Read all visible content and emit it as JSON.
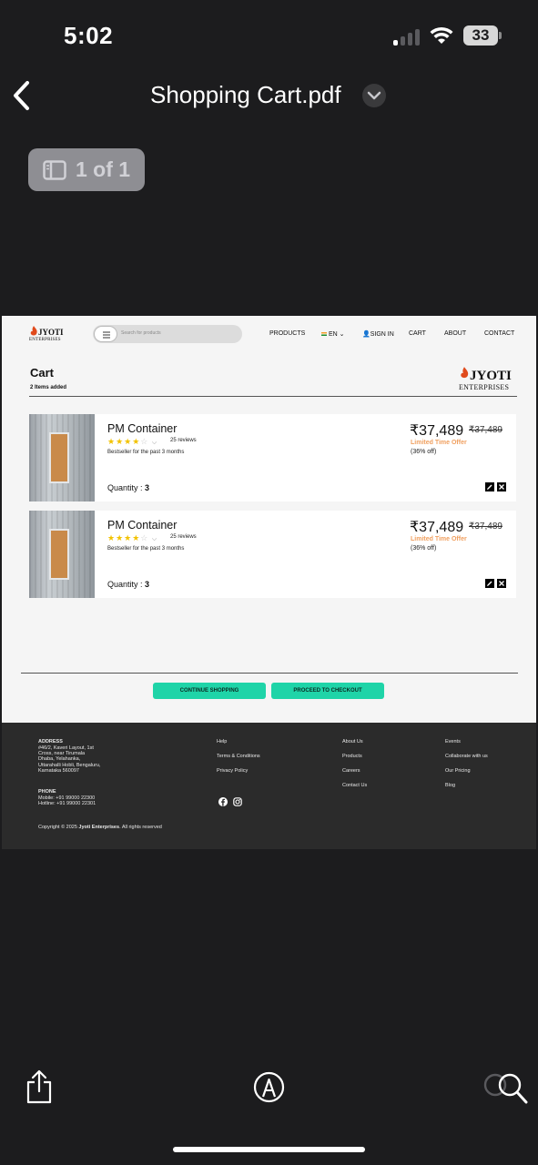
{
  "status_bar": {
    "time": "5:02",
    "battery": "33"
  },
  "header": {
    "title": "Shopping Cart.pdf"
  },
  "page_indicator": "1 of 1",
  "site": {
    "logo_brand": "JYOTI",
    "logo_sub": "ENTERPRISES",
    "search_placeholder": "Search for products",
    "nav": [
      "PRODUCTS",
      "EN",
      "SIGN IN",
      "CART",
      "ABOUT",
      "CONTACT"
    ]
  },
  "cart": {
    "title": "Cart",
    "count": "2 Items added",
    "items": [
      {
        "name": "PM Container",
        "rating": 4,
        "reviews": "25 reviews",
        "desc": "Bestseller for the past 3 months",
        "qty_label": "Quantity :",
        "qty": "3",
        "price": "₹37,489",
        "old_price": "₹37,489",
        "offer": "Limited Time Offer",
        "discount": "(36% off)"
      },
      {
        "name": "PM Container",
        "rating": 4,
        "reviews": "25 reviews",
        "desc": "Bestseller for the past 3 months",
        "qty_label": "Quantity :",
        "qty": "3",
        "price": "₹37,489",
        "old_price": "₹37,489",
        "offer": "Limited Time Offer",
        "discount": "(36% off)"
      }
    ],
    "continue_label": "CONTINUE SHOPPING",
    "checkout_label": "PROCEED TO CHECKOUT"
  },
  "footer": {
    "address_heading": "ADDRESS",
    "address": "#46/2, Kaveri Layout, 1st\nCross, near Tirumala\nDhaba, Yelahanka,\nUttarahalli Hobli, Bengaluru,\nKarnataka 560097",
    "phone_heading": "PHONE",
    "phone": "Mobile: +91 99000 22300\nHotline: +91 99000 22301",
    "col2": [
      "Help",
      "Terms & Conditions",
      "Privacy Policy"
    ],
    "col3": [
      "About Us",
      "Products",
      "Careers",
      "Contact Us"
    ],
    "col4": [
      "Events",
      "Collaborate with us",
      "Our Pricing",
      "Blog"
    ],
    "copyright_prefix": "Copyright © 2025",
    "copyright_brand": "Jyoti Enterprises",
    "copyright_suffix": ". All rights reserved"
  },
  "colors": {
    "accent": "#1fd4a8",
    "offer": "#f0a060",
    "star": "#f2c200",
    "footer_bg": "#2b2b2b"
  }
}
